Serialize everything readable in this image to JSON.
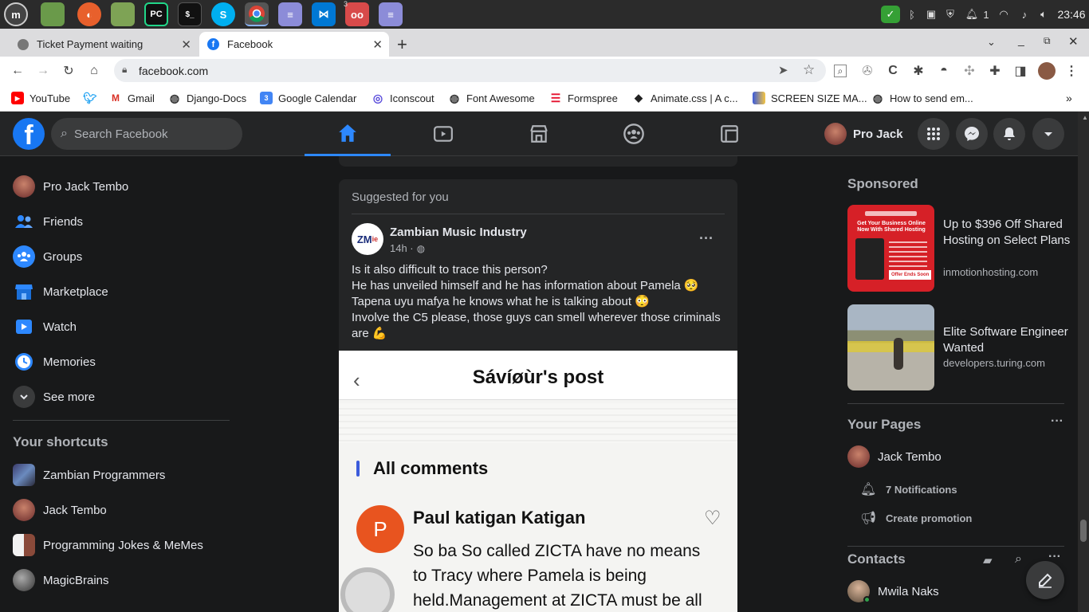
{
  "os": {
    "clock": "23:46",
    "notif_count": "1",
    "taskbar_badge": "3",
    "taskbar": [
      "mint-menu",
      "files",
      "firefox",
      "folder",
      "pycharm",
      "terminal",
      "skype",
      "chrome",
      "text-editor",
      "vscode",
      "glasses",
      "notes"
    ]
  },
  "browser": {
    "tabs": [
      {
        "title": "Ticket Payment waiting",
        "active": false
      },
      {
        "title": "Facebook",
        "active": true
      }
    ],
    "url": "facebook.com",
    "bookmarks": [
      {
        "label": "YouTube",
        "icon": "youtube-icon"
      },
      {
        "label": "",
        "icon": "twitter-icon"
      },
      {
        "label": "Gmail",
        "icon": "gmail-icon"
      },
      {
        "label": "Django-Docs",
        "icon": "globe-icon"
      },
      {
        "label": "Google Calendar",
        "icon": "calendar-icon"
      },
      {
        "label": "Iconscout",
        "icon": "iconscout-icon"
      },
      {
        "label": "Font Awesome",
        "icon": "globe-icon"
      },
      {
        "label": "Formspree",
        "icon": "formspree-icon"
      },
      {
        "label": "Animate.css | A c...",
        "icon": "animate-icon"
      },
      {
        "label": "SCREEN SIZE MA...",
        "icon": "screen-icon"
      },
      {
        "label": "How to send em...",
        "icon": "globe-icon"
      }
    ]
  },
  "fb": {
    "search_placeholder": "Search Facebook",
    "profile_name": "Pro Jack",
    "colors": {
      "accent": "#2d88ff",
      "bg": "#18191a",
      "card": "#242526"
    },
    "left_nav": [
      {
        "label": "Pro Jack Tembo",
        "icon": "avatar"
      },
      {
        "label": "Friends",
        "icon": "friends-icon"
      },
      {
        "label": "Groups",
        "icon": "groups-icon"
      },
      {
        "label": "Marketplace",
        "icon": "marketplace-icon"
      },
      {
        "label": "Watch",
        "icon": "watch-icon"
      },
      {
        "label": "Memories",
        "icon": "memories-icon"
      },
      {
        "label": "See more",
        "icon": "chevron-down-icon"
      }
    ],
    "shortcuts_title": "Your shortcuts",
    "shortcuts": [
      "Zambian Programmers",
      "Jack Tembo",
      "Programming Jokes & MeMes",
      "MagicBrains"
    ],
    "post": {
      "section_label": "Suggested for you",
      "author": "Zambian Music Industry",
      "time": "14h · ",
      "lines": [
        "Is it also difficult to trace this person?",
        "He has unveiled himself and he has information about Pamela 🥺",
        "Tapena uyu mafya he knows what he is talking about 😳",
        "Involve the C5 please, those guys can smell wherever those criminals",
        "are 💪"
      ],
      "image": {
        "title": "Sávíøùr's post",
        "comments_heading": "All comments",
        "commenter": "Paul katigan Katigan",
        "commenter_initial": "P",
        "comment_lines": [
          "So ba So called ZICTA have no means",
          "to Tracy where  Pamela is being",
          "held.Management at ZICTA must be all"
        ]
      }
    },
    "sponsored_title": "Sponsored",
    "ads": [
      {
        "headline": "Up to $396 Off Shared Hosting on Select Plans",
        "domain": "inmotionhosting.com",
        "img_title": "Get Your Business Online Now With Shared Hosting",
        "img_cta": "Offer Ends Soon"
      },
      {
        "headline": "Elite Software Engineer Wanted",
        "domain": "developers.turing.com"
      }
    ],
    "pages_title": "Your Pages",
    "page_name": "Jack Tembo",
    "page_notifications": "7 Notifications",
    "page_promo": "Create promotion",
    "contacts_title": "Contacts",
    "contacts": [
      "Mwila Naks"
    ]
  }
}
